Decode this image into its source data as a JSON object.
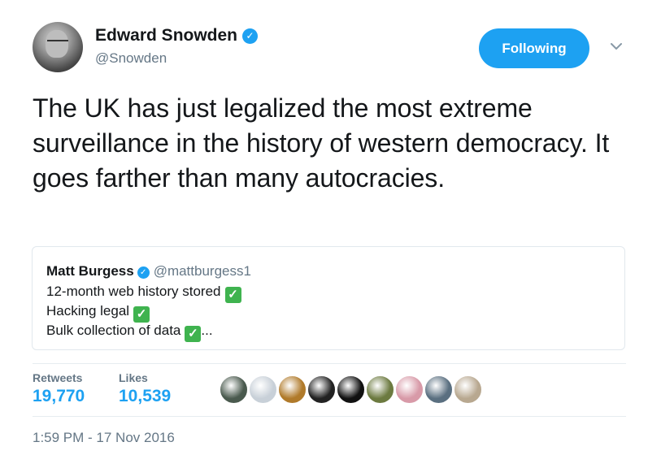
{
  "author": {
    "display_name": "Edward Snowden",
    "handle": "@Snowden",
    "verified_icon": "verified-badge-icon"
  },
  "follow_button": {
    "label": "Following"
  },
  "menu": {
    "icon": "chevron-down-icon"
  },
  "tweet": {
    "text": "The UK has just legalized the most extreme surveillance in the history of western democracy. It goes farther than many autocracies."
  },
  "quoted_tweet": {
    "display_name": "Matt Burgess",
    "handle": "@mattburgess1",
    "lines": [
      {
        "text": "12-month web history stored",
        "suffix": ""
      },
      {
        "text": "Hacking legal",
        "suffix": ""
      },
      {
        "text": "Bulk collection of data",
        "suffix": "..."
      }
    ]
  },
  "stats": {
    "retweets_label": "Retweets",
    "retweets_value": "19,770",
    "likes_label": "Likes",
    "likes_value": "10,539"
  },
  "likers": [
    {
      "color": "#4a5a4e"
    },
    {
      "color": "#c8d0d8"
    },
    {
      "color": "#b07a2a"
    },
    {
      "color": "#222222"
    },
    {
      "color": "#111111"
    },
    {
      "color": "#6c7a40"
    },
    {
      "color": "#d89aa8"
    },
    {
      "color": "#5a6f80"
    },
    {
      "color": "#b8a890"
    }
  ],
  "timestamp": "1:59 PM - 17 Nov 2016",
  "colors": {
    "accent": "#1da1f2",
    "check": "#3fb34f",
    "muted": "#657786"
  }
}
